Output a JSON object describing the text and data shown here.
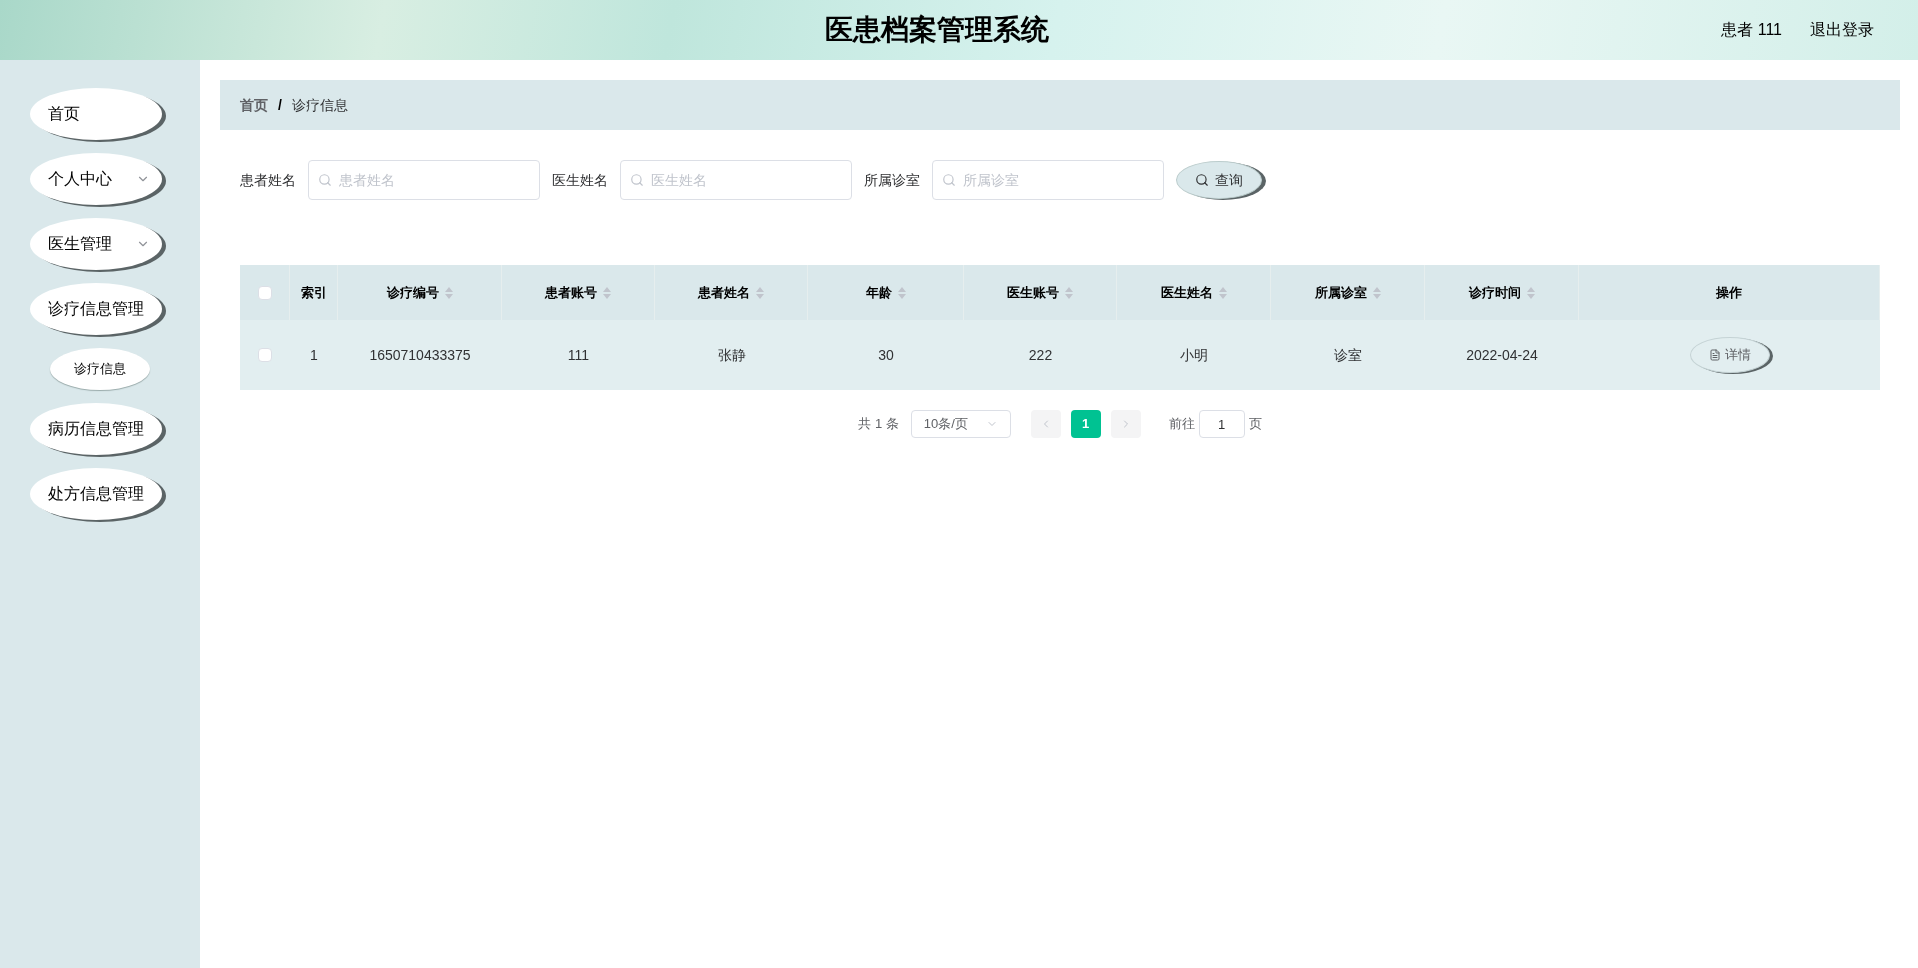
{
  "header": {
    "title": "医患档案管理系统",
    "user": "患者 111",
    "logout": "退出登录"
  },
  "sidebar": {
    "items": [
      {
        "label": "首页",
        "chevron": false
      },
      {
        "label": "个人中心",
        "chevron": true
      },
      {
        "label": "医生管理",
        "chevron": true
      },
      {
        "label": "诊疗信息管理",
        "chevron": false,
        "children": [
          {
            "label": "诊疗信息"
          }
        ]
      },
      {
        "label": "病历信息管理",
        "chevron": false
      },
      {
        "label": "处方信息管理",
        "chevron": false
      }
    ]
  },
  "breadcrumb": [
    "首页",
    "/",
    "诊疗信息"
  ],
  "search": {
    "fields": [
      {
        "label": "患者姓名",
        "placeholder": "患者姓名"
      },
      {
        "label": "医生姓名",
        "placeholder": "医生姓名"
      },
      {
        "label": "所属诊室",
        "placeholder": "所属诊室"
      }
    ],
    "button": "查询"
  },
  "table": {
    "columns": [
      {
        "label": "索引",
        "sortable": false
      },
      {
        "label": "诊疗编号",
        "sortable": true
      },
      {
        "label": "患者账号",
        "sortable": true
      },
      {
        "label": "患者姓名",
        "sortable": true
      },
      {
        "label": "年龄",
        "sortable": true
      },
      {
        "label": "医生账号",
        "sortable": true
      },
      {
        "label": "医生姓名",
        "sortable": true
      },
      {
        "label": "所属诊室",
        "sortable": true
      },
      {
        "label": "诊疗时间",
        "sortable": true
      },
      {
        "label": "操作",
        "sortable": false
      }
    ],
    "header_checked": false,
    "rows": [
      {
        "checked": false,
        "cells": [
          "1",
          "1650710433375",
          "111",
          "张静",
          "30",
          "222",
          "小明",
          "诊室",
          "2022-04-24"
        ],
        "action": "详情"
      }
    ]
  },
  "pagination": {
    "total": "共 1 条",
    "page_size": "10条/页",
    "pages": [
      {
        "label": "1",
        "selected": true
      }
    ],
    "goto_label": "前往",
    "goto_value": "1",
    "goto_suffix": "页"
  }
}
